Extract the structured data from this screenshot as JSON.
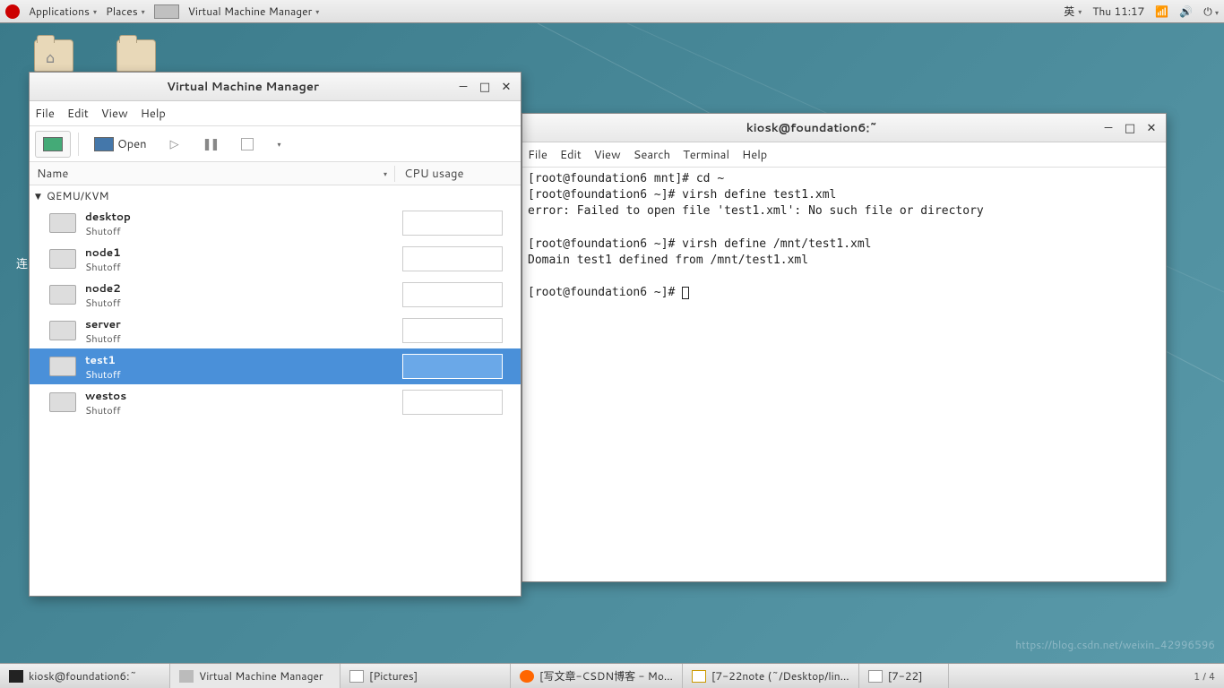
{
  "topbar": {
    "applications": "Applications",
    "places": "Places",
    "vmm": "Virtual Machine Manager",
    "ime": "英",
    "clock": "Thu 11:17"
  },
  "desktop": {
    "partial_label": "连"
  },
  "vmm_window": {
    "title": "Virtual Machine Manager",
    "menu": {
      "file": "File",
      "edit": "Edit",
      "view": "View",
      "help": "Help"
    },
    "toolbar": {
      "open": "Open"
    },
    "columns": {
      "name": "Name",
      "cpu": "CPU usage"
    },
    "group": "QEMU/KVM",
    "vms": [
      {
        "name": "desktop",
        "state": "Shutoff",
        "selected": false
      },
      {
        "name": "node1",
        "state": "Shutoff",
        "selected": false
      },
      {
        "name": "node2",
        "state": "Shutoff",
        "selected": false
      },
      {
        "name": "server",
        "state": "Shutoff",
        "selected": false
      },
      {
        "name": "test1",
        "state": "Shutoff",
        "selected": true
      },
      {
        "name": "westos",
        "state": "Shutoff",
        "selected": false
      }
    ]
  },
  "terminal_window": {
    "title": "kiosk@foundation6:~",
    "menu": {
      "file": "File",
      "edit": "Edit",
      "view": "View",
      "search": "Search",
      "terminal": "Terminal",
      "help": "Help"
    },
    "lines": [
      "[root@foundation6 mnt]# cd ~",
      "[root@foundation6 ~]# virsh define test1.xml",
      "error: Failed to open file 'test1.xml': No such file or directory",
      "",
      "[root@foundation6 ~]# virsh define /mnt/test1.xml",
      "Domain test1 defined from /mnt/test1.xml",
      "",
      "[root@foundation6 ~]# "
    ]
  },
  "taskbar": {
    "items": [
      "kiosk@foundation6:~",
      "Virtual Machine Manager",
      "[Pictures]",
      "[写文章-CSDN博客 - Mo…",
      "[7-22note (~/Desktop/lin…",
      "[7-22]"
    ],
    "workspace": "1 / 4"
  },
  "watermark": "https://blog.csdn.net/weixin_42996596"
}
